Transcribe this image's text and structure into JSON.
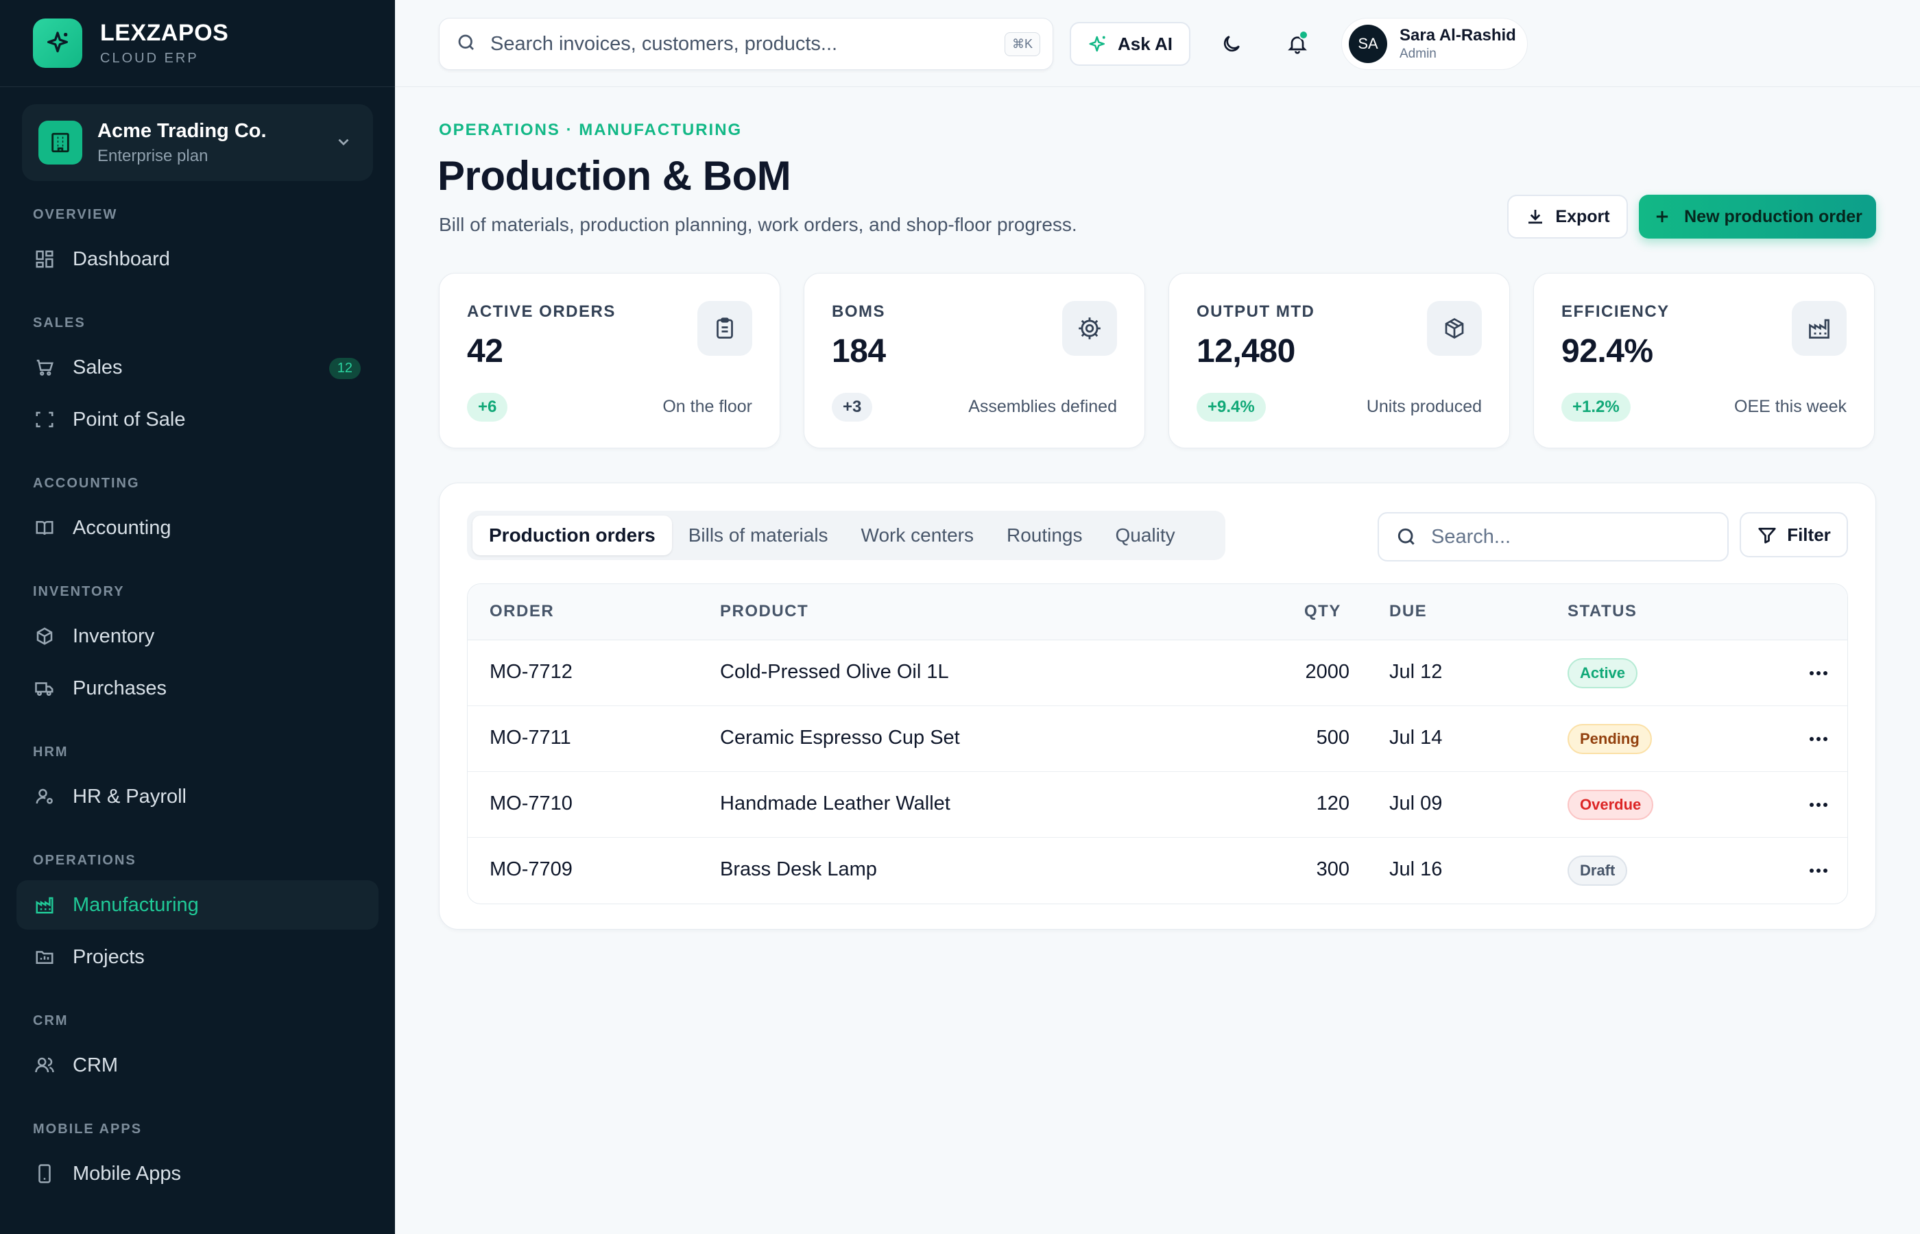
{
  "brand": {
    "name": "LEXZAPOS",
    "sub": "CLOUD ERP"
  },
  "company": {
    "name": "Acme Trading Co.",
    "plan": "Enterprise plan"
  },
  "sidebar": {
    "sections": [
      {
        "label": "OVERVIEW"
      },
      {
        "label": "SALES"
      },
      {
        "label": "ACCOUNTING"
      },
      {
        "label": "INVENTORY"
      },
      {
        "label": "HRM"
      },
      {
        "label": "OPERATIONS"
      },
      {
        "label": "CRM"
      },
      {
        "label": "MOBILE APPS"
      }
    ],
    "items": [
      {
        "label": "Dashboard",
        "icon": "dashboard-icon"
      },
      {
        "label": "Sales",
        "icon": "cart-icon",
        "badge": "12"
      },
      {
        "label": "Point of Sale",
        "icon": "scan-icon"
      },
      {
        "label": "Accounting",
        "icon": "book-icon"
      },
      {
        "label": "Inventory",
        "icon": "box-icon"
      },
      {
        "label": "Purchases",
        "icon": "truck-icon"
      },
      {
        "label": "HR & Payroll",
        "icon": "user-gear-icon"
      },
      {
        "label": "Manufacturing",
        "icon": "factory-icon",
        "active": true
      },
      {
        "label": "Projects",
        "icon": "folder-icon"
      },
      {
        "label": "CRM",
        "icon": "users-icon"
      },
      {
        "label": "Mobile Apps",
        "icon": "phone-icon"
      }
    ]
  },
  "topbar": {
    "search_placeholder": "Search invoices, customers, products...",
    "shortcut": "⌘K",
    "ask_ai": "Ask AI",
    "user": {
      "initials": "SA",
      "name": "Sara Al-Rashid",
      "role": "Admin"
    }
  },
  "header": {
    "eyebrow": "OPERATIONS · MANUFACTURING",
    "title": "Production & BoM",
    "subtitle": "Bill of materials, production planning, work orders, and shop-floor progress.",
    "export_label": "Export",
    "new_label": "New production order"
  },
  "kpis": [
    {
      "label": "ACTIVE ORDERS",
      "value": "42",
      "delta": "+6",
      "note": "On the floor",
      "icon": "clipboard-icon"
    },
    {
      "label": "BOMS",
      "value": "184",
      "delta": "+3",
      "note": "Assemblies defined",
      "icon": "gear-icon"
    },
    {
      "label": "OUTPUT MTD",
      "value": "12,480",
      "delta": "+9.4%",
      "note": "Units produced",
      "icon": "package-icon"
    },
    {
      "label": "EFFICIENCY",
      "value": "92.4%",
      "delta": "+1.2%",
      "note": "OEE this week",
      "icon": "factory-icon"
    }
  ],
  "tabs": [
    {
      "label": "Production orders",
      "active": true
    },
    {
      "label": "Bills of materials"
    },
    {
      "label": "Work centers"
    },
    {
      "label": "Routings"
    },
    {
      "label": "Quality"
    }
  ],
  "table": {
    "search_placeholder": "Search...",
    "filter_label": "Filter",
    "columns": [
      "ORDER",
      "PRODUCT",
      "QTY",
      "DUE",
      "STATUS"
    ],
    "rows": [
      {
        "order": "MO-7712",
        "product": "Cold-Pressed Olive Oil 1L",
        "qty": "2000",
        "due": "Jul 12",
        "status": "Active"
      },
      {
        "order": "MO-7711",
        "product": "Ceramic Espresso Cup Set",
        "qty": "500",
        "due": "Jul 14",
        "status": "Pending"
      },
      {
        "order": "MO-7710",
        "product": "Handmade Leather Wallet",
        "qty": "120",
        "due": "Jul 09",
        "status": "Overdue"
      },
      {
        "order": "MO-7709",
        "product": "Brass Desk Lamp",
        "qty": "300",
        "due": "Jul 16",
        "status": "Draft"
      }
    ]
  },
  "colors": {
    "accent": "#12b886",
    "sidebar_bg": "#0b1a26",
    "status_active": "#10a877",
    "status_pending": "#b45309",
    "status_overdue": "#dc2626",
    "status_draft": "#475569"
  }
}
